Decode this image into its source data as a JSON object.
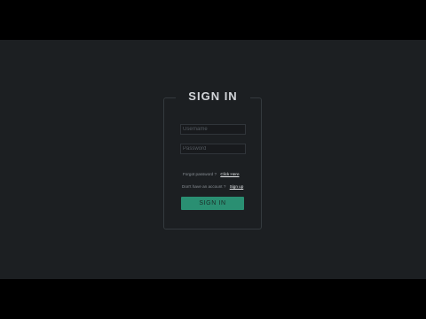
{
  "login": {
    "title": "SIGN IN",
    "username_placeholder": "Username",
    "password_placeholder": "Password",
    "forgot_text": "Forgot password ?",
    "forgot_link": "Click Here",
    "signup_text": "Don't have an account ?",
    "signup_link": "Sign up",
    "submit_label": "SIGN IN"
  },
  "colors": {
    "background": "#1c1f22",
    "accent": "#2a8f72",
    "border": "#343a3e"
  }
}
